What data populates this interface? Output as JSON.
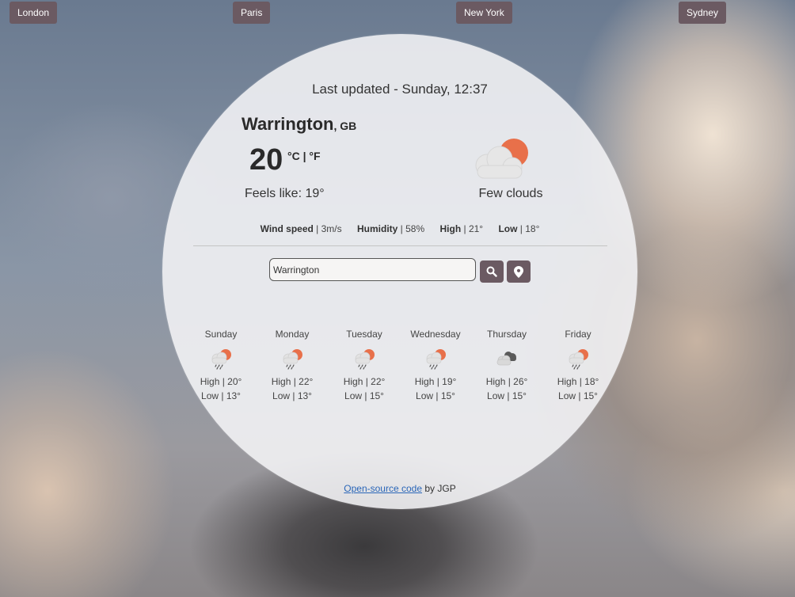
{
  "cities": [
    "London",
    "Paris",
    "New York",
    "Sydney"
  ],
  "last_updated": "Last updated - Sunday, 12:37",
  "current": {
    "city": "Warrington",
    "country": ", GB",
    "temperature": "20",
    "unit_c": "°C",
    "unit_sep": " | ",
    "unit_f": "°F",
    "feels_like": "Feels like: 19°",
    "description": "Few clouds",
    "icon": "few-clouds-icon"
  },
  "stats": {
    "wind_label": "Wind speed",
    "wind_value": " | 3m/s",
    "humidity_label": "Humidity",
    "humidity_value": " | 58%",
    "high_label": "High",
    "high_value": " | 21°",
    "low_label": "Low",
    "low_value": " | 18°"
  },
  "search": {
    "value": "Warrington",
    "search_icon": "search-icon",
    "location_icon": "location-pin-icon"
  },
  "forecast": [
    {
      "day": "Sunday",
      "icon": "rain-sun-icon",
      "high": "High | 20°",
      "low": "Low | 13°"
    },
    {
      "day": "Monday",
      "icon": "rain-sun-icon",
      "high": "High | 22°",
      "low": "Low | 13°"
    },
    {
      "day": "Tuesday",
      "icon": "rain-sun-icon",
      "high": "High | 22°",
      "low": "Low | 15°"
    },
    {
      "day": "Wednesday",
      "icon": "rain-sun-icon",
      "high": "High | 19°",
      "low": "Low | 15°"
    },
    {
      "day": "Thursday",
      "icon": "broken-clouds-icon",
      "high": "High | 26°",
      "low": "Low | 15°"
    },
    {
      "day": "Friday",
      "icon": "rain-sun-icon",
      "high": "High | 18°",
      "low": "Low | 15°"
    }
  ],
  "footer": {
    "link_text": "Open-source code",
    "by_text": " by JGP"
  },
  "colors": {
    "button": "#6b5a62",
    "sun": "#e8704a",
    "link": "#2a66b8"
  }
}
